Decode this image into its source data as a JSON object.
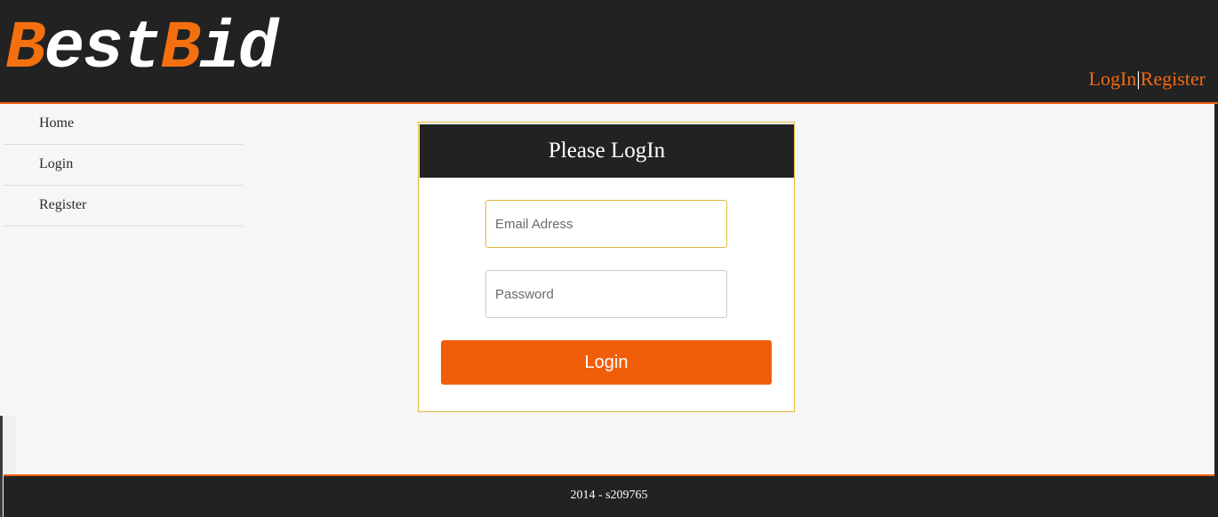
{
  "header": {
    "logo": {
      "part1": "B",
      "part2": "est",
      "part3": "B",
      "part4": "id"
    },
    "links": {
      "login": "LogIn",
      "separator": "|",
      "register": "Register"
    }
  },
  "sidebar": {
    "items": [
      {
        "label": "Home"
      },
      {
        "label": "Login"
      },
      {
        "label": "Register"
      }
    ]
  },
  "login_form": {
    "title": "Please LogIn",
    "email": {
      "value": "",
      "placeholder": "Email Adress"
    },
    "password": {
      "value": "",
      "placeholder": "Password"
    },
    "submit_label": "Login"
  },
  "footer": {
    "text": "2014 - s209765"
  },
  "colors": {
    "accent": "#f05e0a",
    "dark": "#222222",
    "focus_border": "#e2b93b",
    "background": "#f6f6f6"
  }
}
